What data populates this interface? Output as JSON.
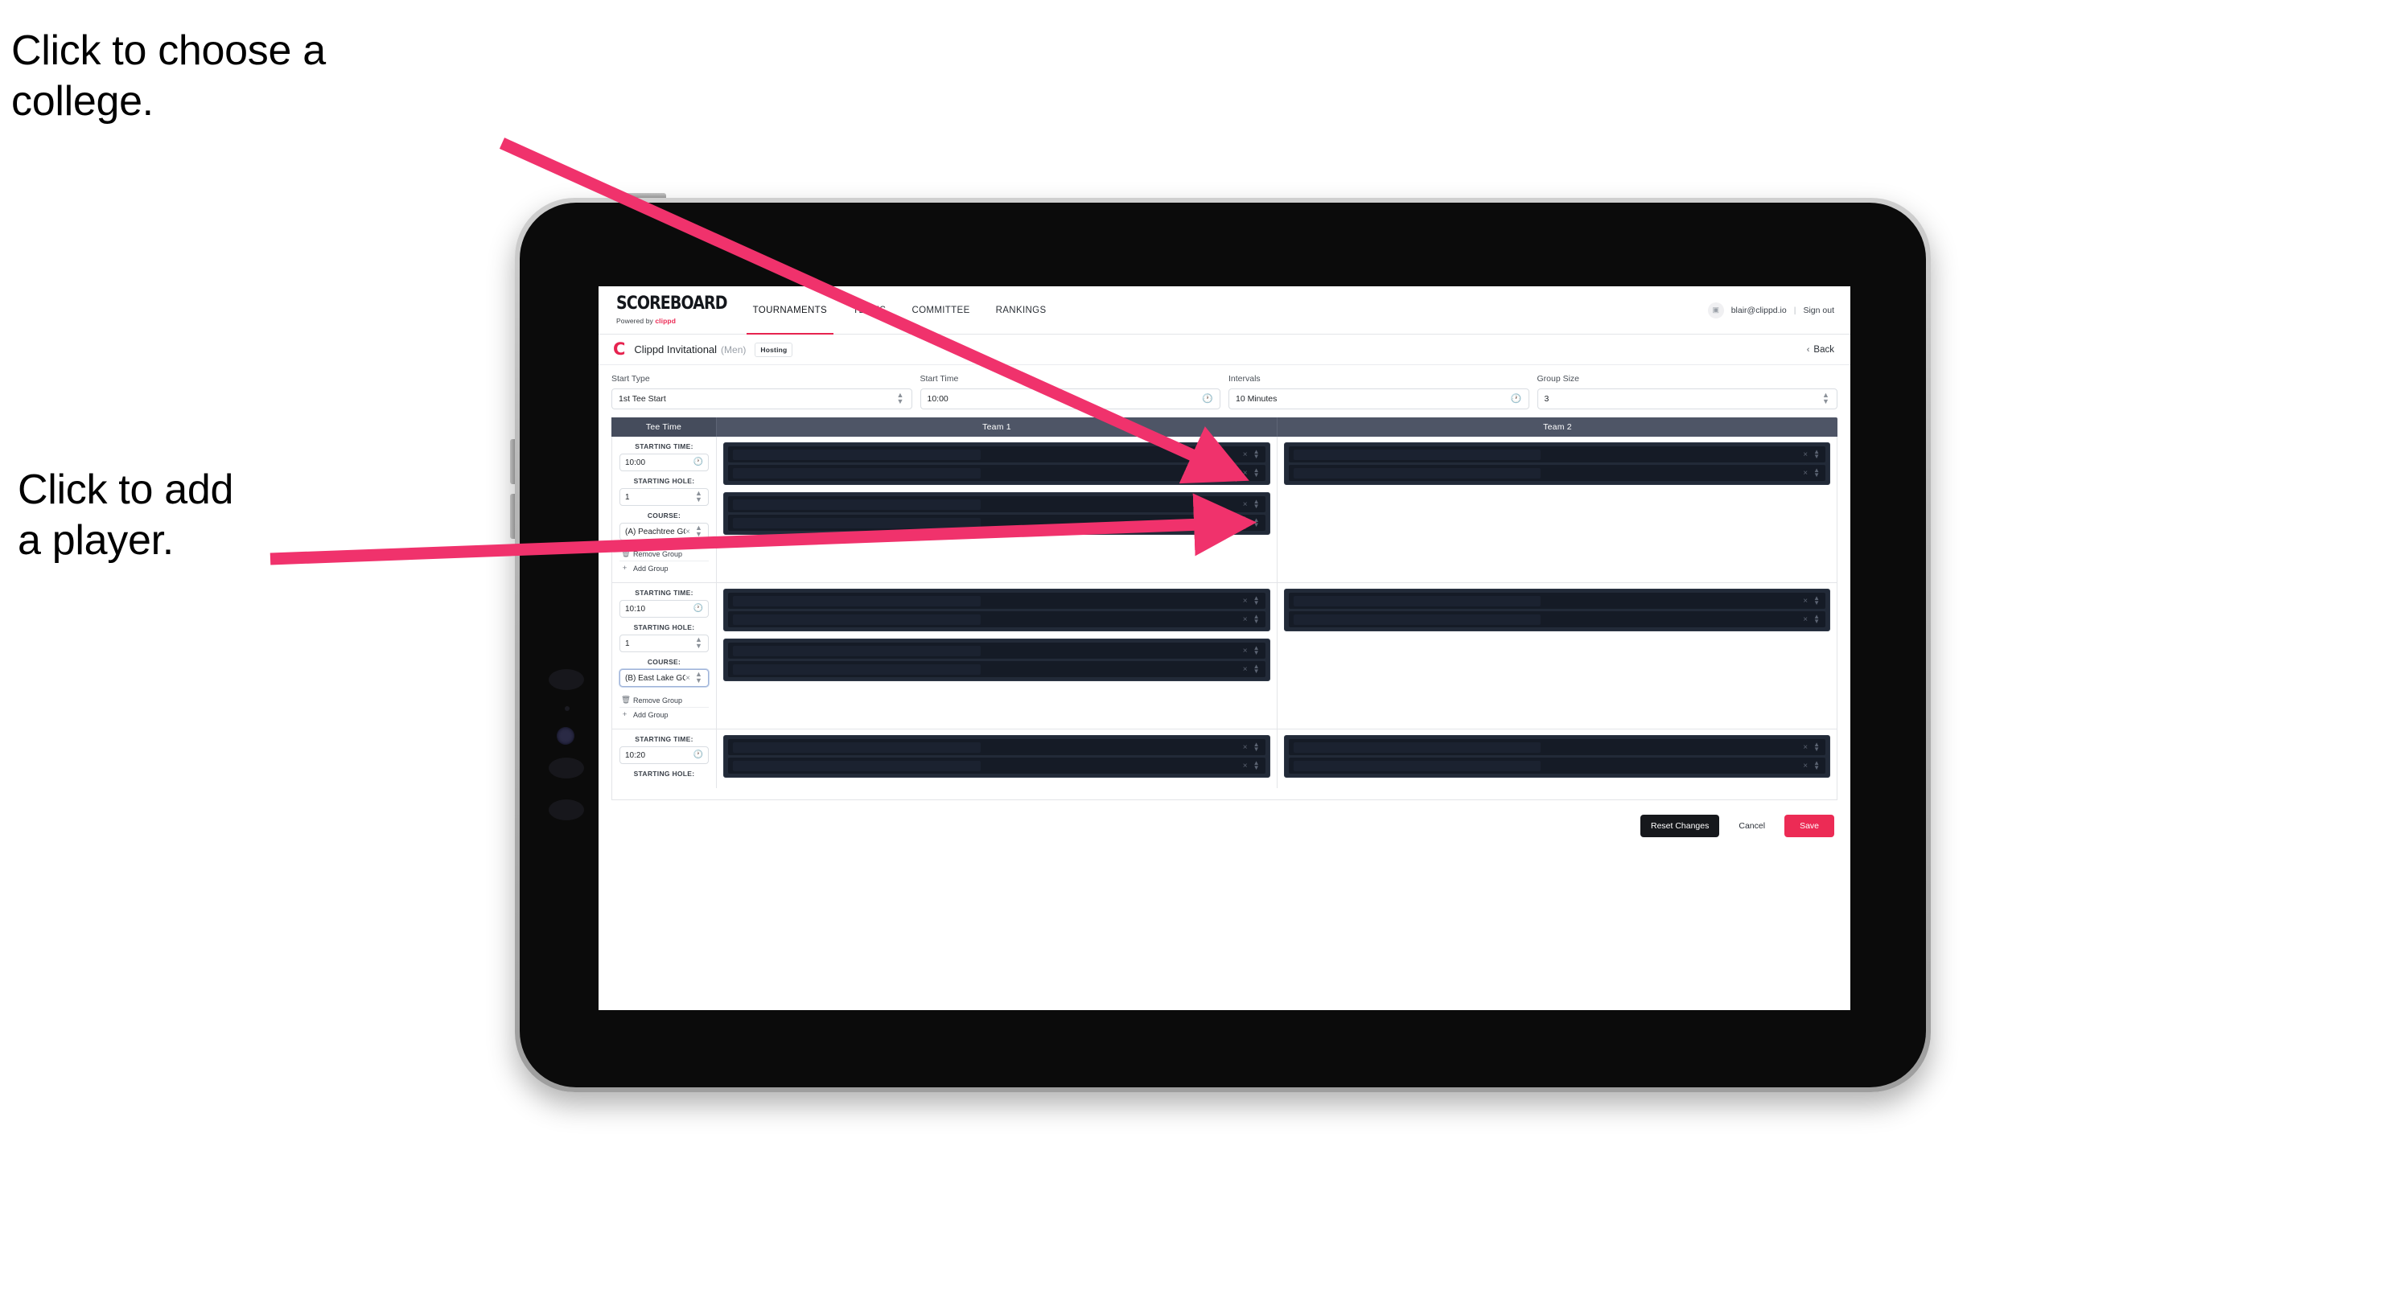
{
  "annotations": {
    "college": "Click to choose a\ncollege.",
    "player": "Click to add\na player."
  },
  "nav": {
    "brand_word": "SCOREBOARD",
    "brand_sub_prefix": "Powered by ",
    "brand_sub_brand": "clippd",
    "links": [
      {
        "label": "TOURNAMENTS",
        "active": true
      },
      {
        "label": "TEAMS",
        "active": false
      },
      {
        "label": "COMMITTEE",
        "active": false
      },
      {
        "label": "RANKINGS",
        "active": false
      }
    ],
    "avatar_icon": "user-avatar-icon",
    "user_email": "blair@clippd.io",
    "separator": "|",
    "sign_out": "Sign out"
  },
  "tournament": {
    "logo_letter": "C",
    "name": "Clippd Invitational",
    "gender": "(Men)",
    "badge": "Hosting",
    "back_label": "Back",
    "back_icon": "chevron-left-icon"
  },
  "form": {
    "fields": [
      {
        "label": "Start Type",
        "value": "1st Tee Start",
        "control": "stepper"
      },
      {
        "label": "Start Time",
        "value": "10:00",
        "control": "clock"
      },
      {
        "label": "Intervals",
        "value": "10 Minutes",
        "control": "clock"
      },
      {
        "label": "Group Size",
        "value": "3",
        "control": "stepper"
      }
    ]
  },
  "table": {
    "headers": {
      "tee": "Tee Time",
      "team1": "Team 1",
      "team2": "Team 2"
    },
    "labels": {
      "starting_time": "STARTING TIME:",
      "starting_hole": "STARTING HOLE:",
      "course": "COURSE:",
      "remove_group": "Remove Group",
      "add_group": "Add Group",
      "remove_icon": "trash-icon",
      "add_icon": "plus-icon",
      "clear_icon": "close-x-icon",
      "stepper_icon": "chevron-updown-icon",
      "clock_icon": "clock-icon"
    },
    "rows": [
      {
        "starting_time": "10:00",
        "starting_hole": "1",
        "course": "(A) Peachtree GC",
        "course_focused": false,
        "team1_groups": [
          2,
          2
        ],
        "team2_groups": [
          2
        ]
      },
      {
        "starting_time": "10:10",
        "starting_hole": "1",
        "course": "(B) East Lake GC",
        "course_focused": true,
        "team1_groups": [
          2,
          2
        ],
        "team2_groups": [
          2
        ]
      },
      {
        "starting_time": "10:20",
        "starting_hole": "",
        "course": "",
        "course_focused": false,
        "team1_groups": [
          2
        ],
        "team2_groups": [
          2
        ]
      }
    ]
  },
  "footer": {
    "reset": "Reset Changes",
    "cancel": "Cancel",
    "save": "Save"
  },
  "colors": {
    "accent_pink": "#ec2b55",
    "arrow_pink": "#f0326c",
    "header_slate": "#4e5566",
    "slot_dark": "#151b26"
  }
}
